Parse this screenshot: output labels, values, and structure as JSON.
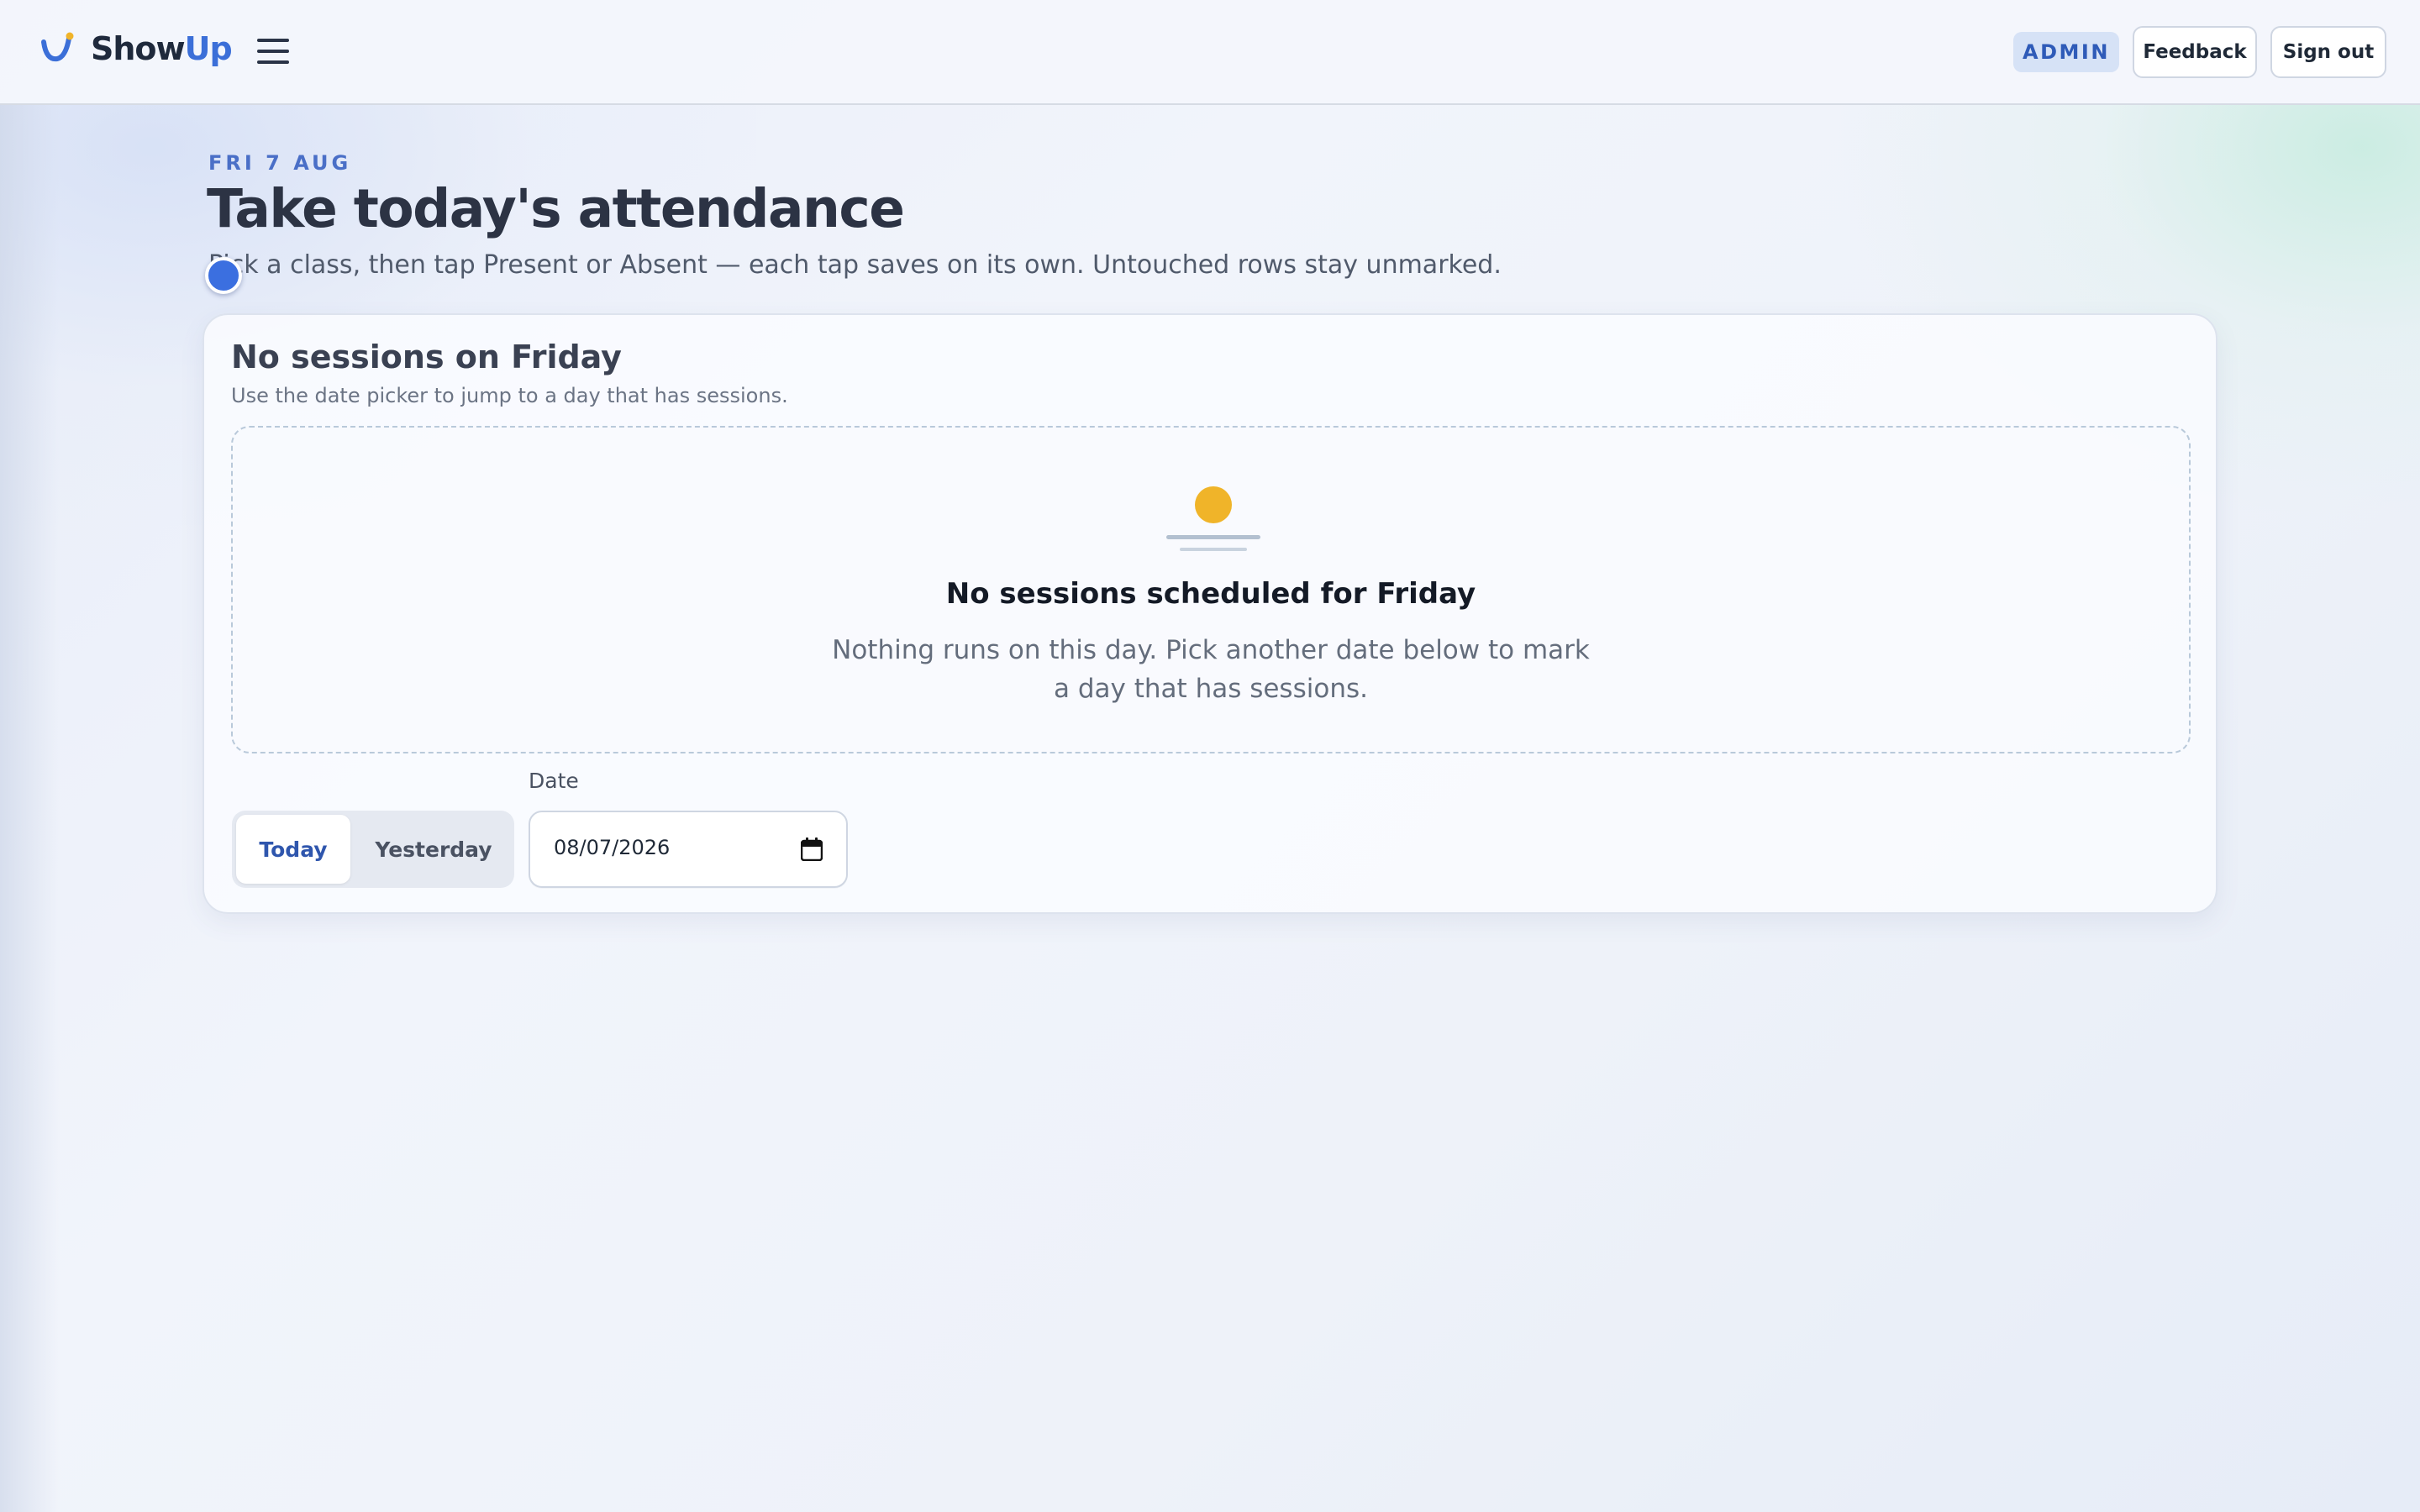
{
  "brand": {
    "name_main": "Show",
    "name_accent": "Up"
  },
  "header": {
    "role_badge": "ADMIN",
    "feedback_label": "Feedback",
    "signout_label": "Sign out"
  },
  "page": {
    "eyebrow": "FRI 7 AUG",
    "title": "Take today's attendance",
    "subtitle": "Pick a class, then tap Present or Absent — each tap saves on its own. Untouched rows stay unmarked."
  },
  "card": {
    "title": "No sessions on Friday",
    "subtitle": "Use the date picker to jump to a day that has sessions.",
    "empty_title": "No sessions scheduled for Friday",
    "empty_text": "Nothing runs on this day. Pick another date below to mark a day that has sessions."
  },
  "date_controls": {
    "label": "Date",
    "today_label": "Today",
    "yesterday_label": "Yesterday",
    "selected": "Today",
    "date_value": "08/07/2026"
  },
  "colors": {
    "accent": "#3b6fd8",
    "sun": "#f0b429",
    "badge_bg": "#d6e2f6"
  },
  "icons": {
    "brand": "showup-check-logo-icon",
    "menu": "hamburger-menu-icon",
    "empty_state": "sunrise-icon",
    "date": "calendar-icon"
  }
}
